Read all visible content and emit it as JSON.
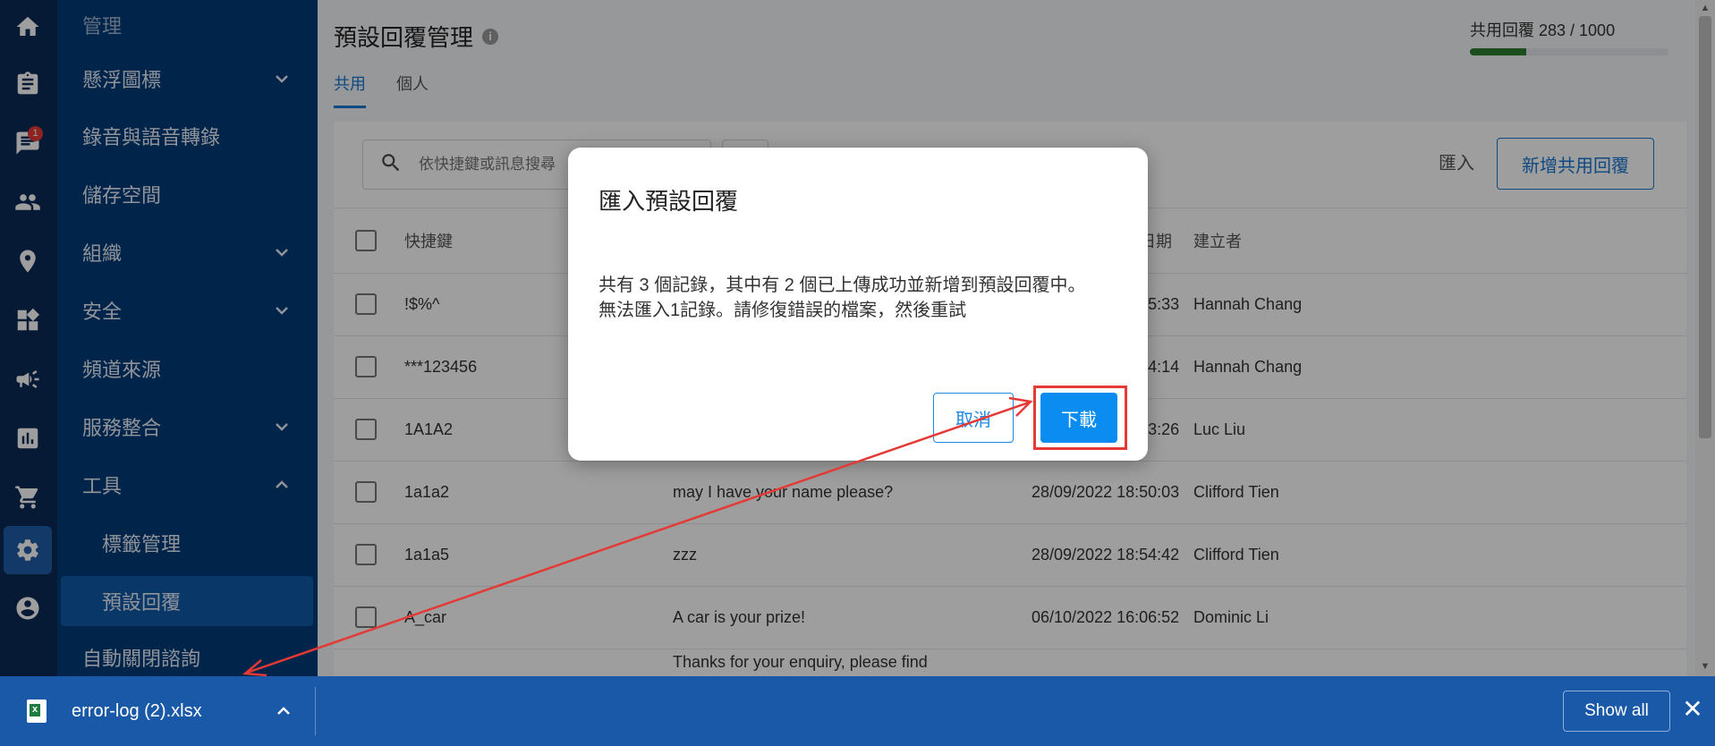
{
  "rail": {
    "badge_count": "1"
  },
  "nav": {
    "items": [
      {
        "label": "管理"
      },
      {
        "label": "懸浮圖標"
      },
      {
        "label": "錄音與語音轉錄"
      },
      {
        "label": "儲存空間"
      },
      {
        "label": "組織"
      },
      {
        "label": "安全"
      },
      {
        "label": "頻道來源"
      },
      {
        "label": "服務整合"
      },
      {
        "label": "工具"
      },
      {
        "label": "標籤管理"
      },
      {
        "label": "預設回覆"
      },
      {
        "label": "自動關閉諮詢"
      }
    ]
  },
  "main": {
    "title": "預設回覆管理",
    "info_icon": "i",
    "quota_text": "共用回覆 283 / 1000",
    "quota_fraction": 0.283,
    "tabs": [
      {
        "label": "共用"
      },
      {
        "label": "個人"
      }
    ],
    "search_placeholder": "依快捷鍵或訊息搜尋",
    "import_label": "匯入",
    "add_label": "新增共用回覆",
    "columns": {
      "shortcut": "快捷鍵",
      "created_date": "建立日期",
      "creator": "建立者"
    },
    "rows": [
      {
        "shortcut": "!$%^",
        "message": "",
        "date": "17/10/2022 17:55:33",
        "creator": "Hannah Chang"
      },
      {
        "shortcut": "***123456",
        "message": "",
        "date": "17/10/2022 17:54:14",
        "creator": "Hannah Chang"
      },
      {
        "shortcut": "1A1A2",
        "message": "",
        "date": "29/09/2022 10:53:26",
        "creator": "Luc Liu"
      },
      {
        "shortcut": "1a1a2",
        "message": "may I have your name please?",
        "date": "28/09/2022 18:50:03",
        "creator": "Clifford Tien"
      },
      {
        "shortcut": "1a1a5",
        "message": "zzz",
        "date": "28/09/2022 18:54:42",
        "creator": "Clifford Tien"
      },
      {
        "shortcut": "A_car",
        "message": "A car is your prize!",
        "date": "06/10/2022 16:06:52",
        "creator": "Dominic Li"
      },
      {
        "shortcut": "",
        "message": "Thanks for your enquiry, please find",
        "date": "",
        "creator": ""
      }
    ]
  },
  "modal": {
    "title": "匯入預設回覆",
    "line1": "共有 3 個記錄，其中有 2 個已上傳成功並新增到預設回覆中。",
    "line2": "無法匯入1記錄。請修復錯誤的檔案，然後重試",
    "cancel_label": "取消",
    "download_label": "下載"
  },
  "download_bar": {
    "filename": "error-log (2).xlsx",
    "show_all_label": "Show all",
    "close_glyph": "✕"
  },
  "colors": {
    "rail_bg": "#0a2a57",
    "nav_bg": "#003a78",
    "accent": "#1976d2",
    "download_btn": "#0a8cf0",
    "annotation": "#e53935"
  }
}
